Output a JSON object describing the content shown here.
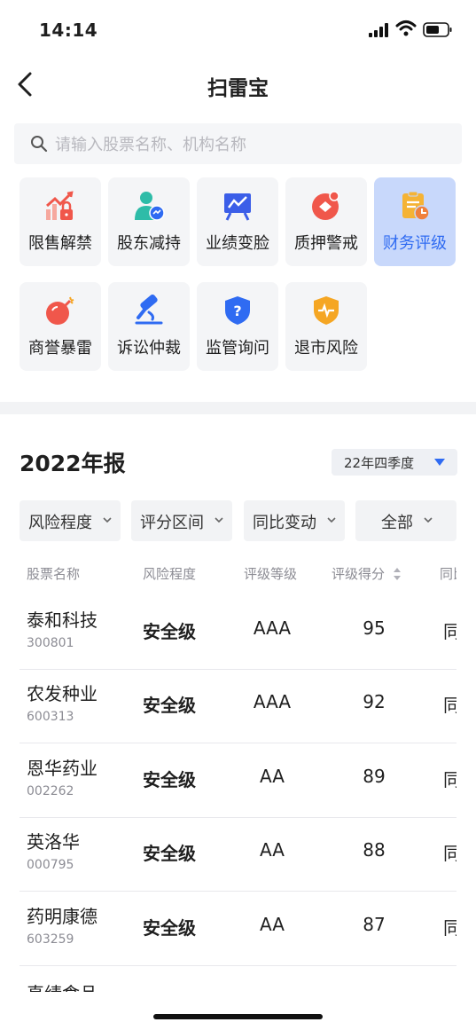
{
  "status_bar": {
    "time": "14:14"
  },
  "nav": {
    "title": "扫雷宝"
  },
  "search": {
    "placeholder": "请输入股票名称、机构名称"
  },
  "categories": [
    {
      "label": "限售解禁",
      "icon": "unlock-chart-icon",
      "active": false
    },
    {
      "label": "股东减持",
      "icon": "shareholder-icon",
      "active": false
    },
    {
      "label": "业绩变脸",
      "icon": "performance-board-icon",
      "active": false
    },
    {
      "label": "质押警戒",
      "icon": "pledge-icon",
      "active": false
    },
    {
      "label": "财务评级",
      "icon": "finance-rating-icon",
      "active": true
    },
    {
      "label": "商誉暴雷",
      "icon": "bomb-icon",
      "active": false
    },
    {
      "label": "诉讼仲裁",
      "icon": "gavel-icon",
      "active": false
    },
    {
      "label": "监管询问",
      "icon": "shield-question-icon",
      "active": false
    },
    {
      "label": "退市风险",
      "icon": "shield-pulse-icon",
      "active": false
    }
  ],
  "report": {
    "title": "2022年报",
    "quarter_selector": "22年四季度"
  },
  "filters": [
    {
      "label": "风险程度"
    },
    {
      "label": "评分区间"
    },
    {
      "label": "同比变动"
    },
    {
      "label": "全部"
    }
  ],
  "table": {
    "headers": [
      "股票名称",
      "风险程度",
      "评级等级",
      "评级得分",
      "同比"
    ],
    "rows": [
      {
        "name": "泰和科技",
        "code": "300801",
        "risk": "安全级",
        "grade": "AAA",
        "score": "95",
        "yoy": "同"
      },
      {
        "name": "农发种业",
        "code": "600313",
        "risk": "安全级",
        "grade": "AAA",
        "score": "92",
        "yoy": "同"
      },
      {
        "name": "恩华药业",
        "code": "002262",
        "risk": "安全级",
        "grade": "AA",
        "score": "89",
        "yoy": "同"
      },
      {
        "name": "英洛华",
        "code": "000795",
        "risk": "安全级",
        "grade": "AA",
        "score": "88",
        "yoy": "同"
      },
      {
        "name": "药明康德",
        "code": "603259",
        "risk": "安全级",
        "grade": "AA",
        "score": "87",
        "yoy": "同"
      }
    ],
    "partial_row_name": "真绩食品"
  },
  "colors": {
    "accent": "#2f6bf2",
    "active_tile": "#c8d8fb",
    "tile": "#f4f5f7",
    "icon_red": "#f0574b",
    "icon_blue": "#2f6bf2",
    "icon_orange": "#f5a623",
    "icon_teal": "#2ebca8"
  }
}
